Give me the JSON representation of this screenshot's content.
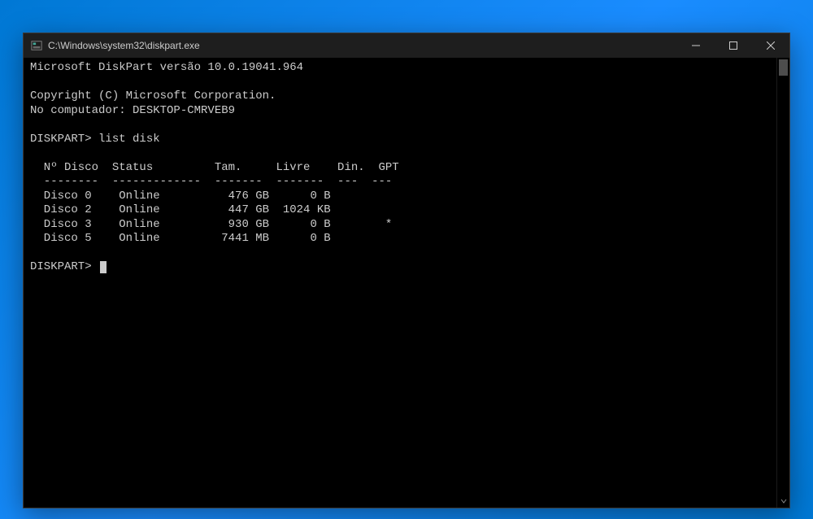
{
  "window": {
    "title": "C:\\Windows\\system32\\diskpart.exe"
  },
  "terminal": {
    "header_line": "Microsoft DiskPart versão 10.0.19041.964",
    "copyright": "Copyright (C) Microsoft Corporation.",
    "computer_line": "No computador: DESKTOP-CMRVEB9",
    "prompt1": "DISKPART> ",
    "command1": "list disk",
    "table_header": "  Nº Disco  Status         Tam.     Livre    Din.  GPT",
    "table_divider": "  --------  -------------  -------  -------  ---  ---",
    "rows": [
      "  Disco 0    Online          476 GB      0 B",
      "  Disco 2    Online          447 GB  1024 KB",
      "  Disco 3    Online          930 GB      0 B        *",
      "  Disco 5    Online         7441 MB      0 B"
    ],
    "prompt2": "DISKPART> "
  },
  "chart_data": {
    "type": "table",
    "title": "DiskPart list disk",
    "columns": [
      "Nº Disco",
      "Status",
      "Tam.",
      "Livre",
      "Din.",
      "GPT"
    ],
    "rows": [
      {
        "disk": "Disco 0",
        "status": "Online",
        "size": "476 GB",
        "free": "0 B",
        "dyn": "",
        "gpt": ""
      },
      {
        "disk": "Disco 2",
        "status": "Online",
        "size": "447 GB",
        "free": "1024 KB",
        "dyn": "",
        "gpt": ""
      },
      {
        "disk": "Disco 3",
        "status": "Online",
        "size": "930 GB",
        "free": "0 B",
        "dyn": "",
        "gpt": "*"
      },
      {
        "disk": "Disco 5",
        "status": "Online",
        "size": "7441 MB",
        "free": "0 B",
        "dyn": "",
        "gpt": ""
      }
    ]
  }
}
